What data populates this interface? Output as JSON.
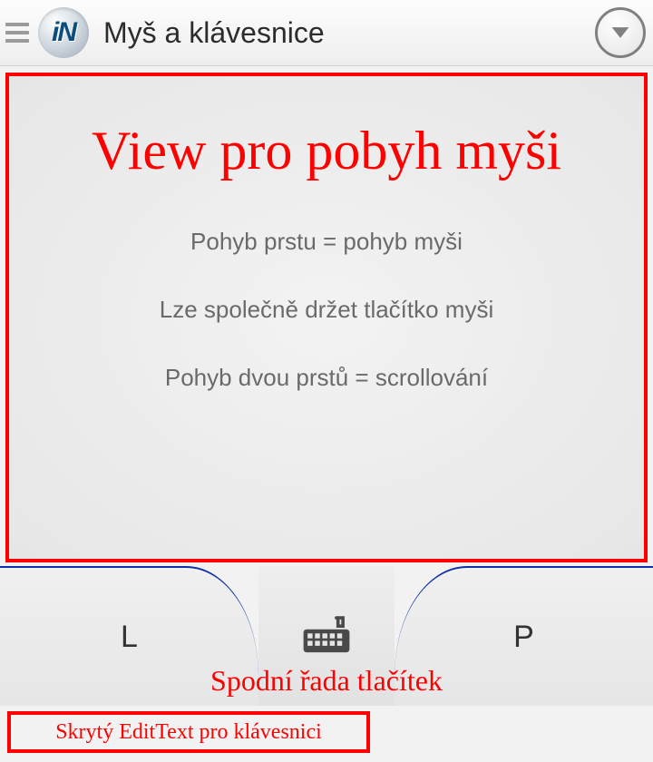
{
  "header": {
    "logo_text": "iN",
    "title": "Myš a klávesnice"
  },
  "touch_area": {
    "annotation_title": "View pro pobyh myši",
    "hints": [
      "Pohyb prstu = pohyb myši",
      "Lze společně držet tlačítko myši",
      "Pohyb dvou prstů = scrollování"
    ]
  },
  "buttons": {
    "left_label": "L",
    "right_label": "P",
    "row_annotation": "Spodní řada tlačítek"
  },
  "hidden_edit": {
    "annotation": "Skrytý EditText pro klávesnici"
  },
  "colors": {
    "annotation_red": "#ff0000",
    "accent_blue": "#1030a8"
  }
}
